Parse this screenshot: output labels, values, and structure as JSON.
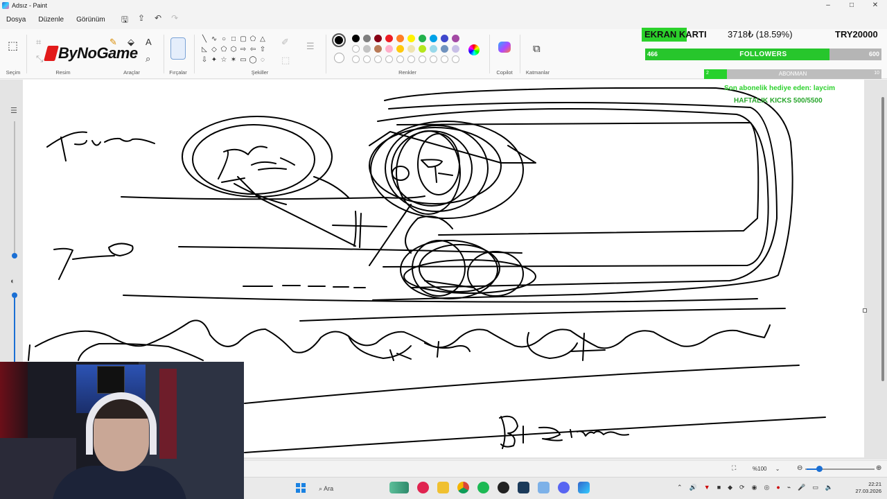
{
  "window": {
    "title": "Adsız - Paint",
    "controls": [
      "–",
      "□",
      "✕"
    ]
  },
  "menu": [
    "Dosya",
    "Düzenle",
    "Görünüm"
  ],
  "ribbon": {
    "groups": {
      "selection": "Seçim",
      "image": "Resim",
      "tools": "Araçlar",
      "brushes": "Fırçalar",
      "shapes": "Şekiller",
      "colors": "Renkler",
      "copilot": "Copilot",
      "layers": "Katmanlar"
    },
    "watermark": "ByNoGame",
    "palette_row1": [
      "#000000",
      "#7f7f7f",
      "#880015",
      "#ed1c24",
      "#ff7f27",
      "#fff200",
      "#22b14c",
      "#00a2e8",
      "#3f48cc",
      "#a349a4"
    ],
    "palette_row2": [
      "#ffffff",
      "#c3c3c3",
      "#b97a57",
      "#ffaec9",
      "#ffc90e",
      "#efe4b0",
      "#b5e61d",
      "#99d9ea",
      "#7092be",
      "#c8bfe7"
    ]
  },
  "overlay": {
    "gpu_label": "EKRAN KARTI",
    "amount": "3718₺ (18.59%)",
    "goal": "TRY20000",
    "followers_current": "466",
    "followers_label": "FOLLOWERS",
    "followers_goal": "600",
    "followers_progress": 0.78,
    "sub_current": "2",
    "sub_label": "ABONMAN",
    "sub_goal": "10",
    "sub_progress": 0.13,
    "last_gift": "Son abonelik hediye eden: laycim",
    "weekly_kicks": "HAFTALIK KICKS 500/5500"
  },
  "status": {
    "zoom": "%100"
  },
  "taskbar": {
    "search_placeholder": "Ara",
    "time": "22:21",
    "date": "27.03.2026"
  }
}
